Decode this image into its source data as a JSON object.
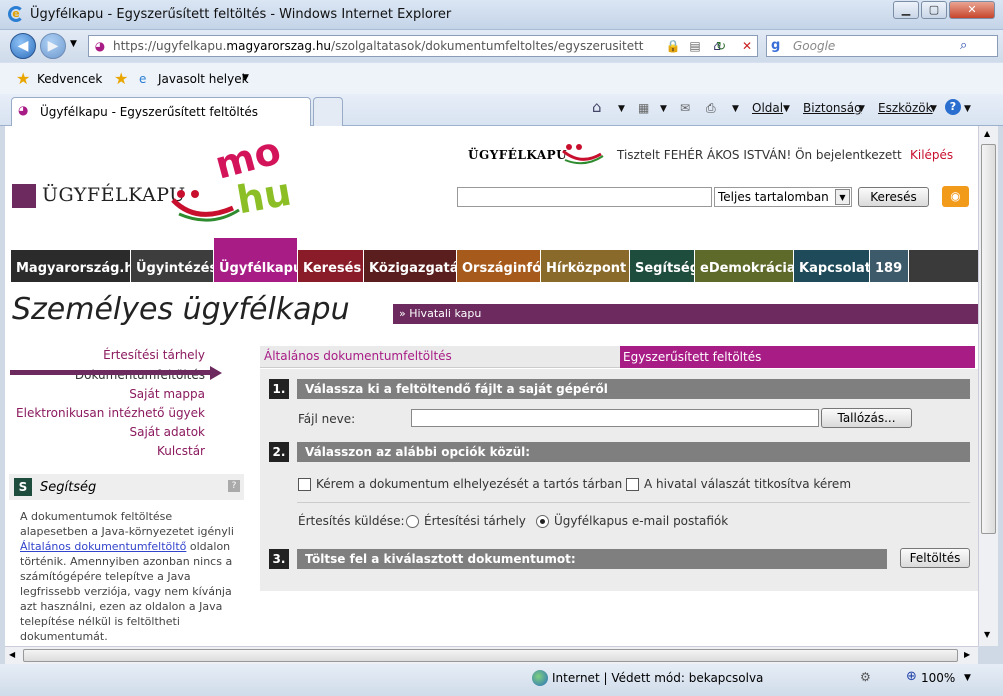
{
  "window": {
    "title": "Ügyfélkapu - Egyszerűsített feltöltés - Windows Internet Explorer",
    "address_https": "https://ugyfelkapu.",
    "address_domain": "magyarorszag.hu",
    "address_path": "/szolgaltatasok/dokumentumfeltoltes/egyszerusitett",
    "search_placeholder": "Google",
    "favorites_label": "Kedvencek",
    "suggested_label": "Javasolt helyek",
    "tab_title": "Ügyfélkapu - Egyszerűsített feltöltés",
    "tools": {
      "page": "Oldal",
      "security": "Biztonság",
      "tools": "Eszközök"
    },
    "status_text": "Internet | Védett mód: bekapcsolva",
    "zoom": "100%"
  },
  "header": {
    "brand": "ÜGYFÉLKAPU",
    "mohu_top": "mo",
    "mohu_bottom": "hu",
    "small_brand": "ÜGYFÉLKAPU",
    "greeting": "Tisztelt FEHÉR ÁKOS ISTVÁN! Ön bejelentkezett",
    "logout": "Kilépés",
    "scope_selected": "Teljes tartalomban",
    "search_button": "Keresés"
  },
  "menu": [
    {
      "label": "Magyarország.hu",
      "color": "#2b2b2b"
    },
    {
      "label": "Ügyintézés",
      "color": "#3d3d3d"
    },
    {
      "label": "Ügyfélkapu",
      "color": "#a81c86"
    },
    {
      "label": "Keresés",
      "color": "#8a1c2a"
    },
    {
      "label": "Közigazgatás",
      "color": "#5a1e1e"
    },
    {
      "label": "Országinfó",
      "color": "#a65a1c"
    },
    {
      "label": "Hírközpont",
      "color": "#8a6a2a"
    },
    {
      "label": "Segítség",
      "color": "#1f4d3d"
    },
    {
      "label": "eDemokrácia",
      "color": "#5d6a2a"
    },
    {
      "label": "Kapcsolat",
      "color": "#1e4a5a"
    },
    {
      "label": "189",
      "color": "#3d5a6a"
    }
  ],
  "page_title": "Személyes ügyfélkapu",
  "office_gate": "Hivatali kapu",
  "sidebar": {
    "links": [
      "Értesítési tárhely",
      "Dokumentumfeltöltés",
      "Saját mappa",
      "Elektronikusan intézhető ügyek",
      "Saját adatok",
      "Kulcstár"
    ],
    "help_letter": "S",
    "help_title": "Segítség",
    "help_text_1": "A dokumentumok feltöltése alapesetben a Java-környezetet igényli",
    "help_link": "Általános dokumentumfeltöltő",
    "help_text_2": "oldalon történik. Amennyiben azonban nincs a számítógépére telepítve a Java legfrissebb verziója, vagy nem kívánja azt használni, ezen az oldalon a Java telepítése nélkül is feltöltheti dokumentumát."
  },
  "tabs": {
    "general": "Általános dokumentumfeltöltés",
    "simplified": "Egyszerűsített feltöltés"
  },
  "form": {
    "step1_num": "1.",
    "step1_title": "Válassza ki a feltöltendő fájlt a saját gépéről",
    "file_label": "Fájl neve:",
    "browse_button": "Tallózás...",
    "step2_num": "2.",
    "step2_title": "Válasszon az alábbi opciók közül:",
    "option_store": "Kérem a dokumentum elhelyezését a tartós tárban is",
    "option_encrypt": "A hivatal válaszát titkosítva kérem",
    "notify_label": "Értesítés küldése:",
    "notify_storage": "Értesítési tárhely",
    "notify_email": "Ügyfélkapus e-mail postafiók",
    "notify_selected": "email",
    "step3_num": "3.",
    "step3_title": "Töltse fel a kiválasztott dokumentumot:",
    "upload_button": "Feltöltés"
  }
}
